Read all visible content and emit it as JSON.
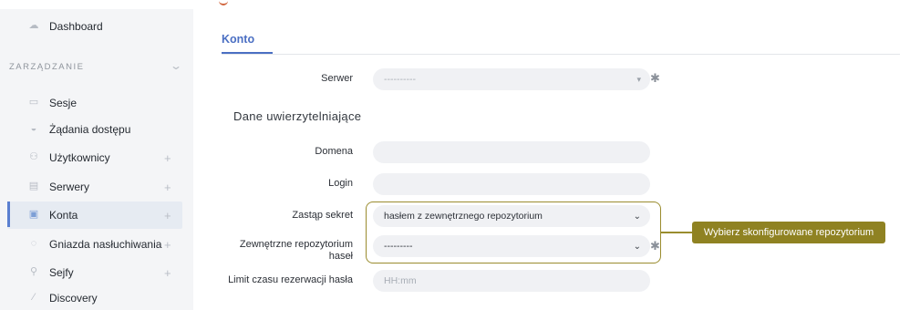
{
  "sidebar": {
    "items": [
      {
        "label": "Dashboard",
        "icon": "dashboard-icon"
      },
      {
        "label": "Sesje",
        "icon": "sessions-icon"
      },
      {
        "label": "Żądania dostępu",
        "icon": "access-requests-icon"
      },
      {
        "label": "Użytkownicy",
        "icon": "users-icon",
        "plus": "+"
      },
      {
        "label": "Serwery",
        "icon": "servers-icon",
        "plus": "+"
      },
      {
        "label": "Konta",
        "icon": "accounts-icon",
        "plus": "+"
      },
      {
        "label": "Gniazda nasłuchiwania",
        "icon": "listeners-icon",
        "plus": "+"
      },
      {
        "label": "Sejfy",
        "icon": "safes-icon",
        "plus": "+"
      },
      {
        "label": "Discovery",
        "icon": "discovery-icon"
      }
    ],
    "section_header": "ZARZĄDZANIE",
    "active_item": "Konta"
  },
  "tabs": [
    {
      "label": "Konto"
    }
  ],
  "form": {
    "server": {
      "label": "Serwer",
      "value": "----------"
    },
    "section_title": "Dane uwierzytelniające",
    "domain": {
      "label": "Domena",
      "value": ""
    },
    "login": {
      "label": "Login",
      "value": ""
    },
    "replace_secret": {
      "label": "Zastąp sekret",
      "value": "hasłem z zewnętrznego repozytorium"
    },
    "external_repo": {
      "label_line1": "Zewnętrzne repozytorium",
      "label_line2": "haseł",
      "value": "---------"
    },
    "reservation_limit": {
      "label": "Limit czasu rezerwacji hasła",
      "placeholder": "HH:mm"
    }
  },
  "callout": {
    "text": "Wybierz skonfigurowane repozytorium"
  },
  "colors": {
    "accent": "#4b6fc3",
    "highlight": "#8f8222",
    "sidebar_bg": "#f4f5f7"
  }
}
